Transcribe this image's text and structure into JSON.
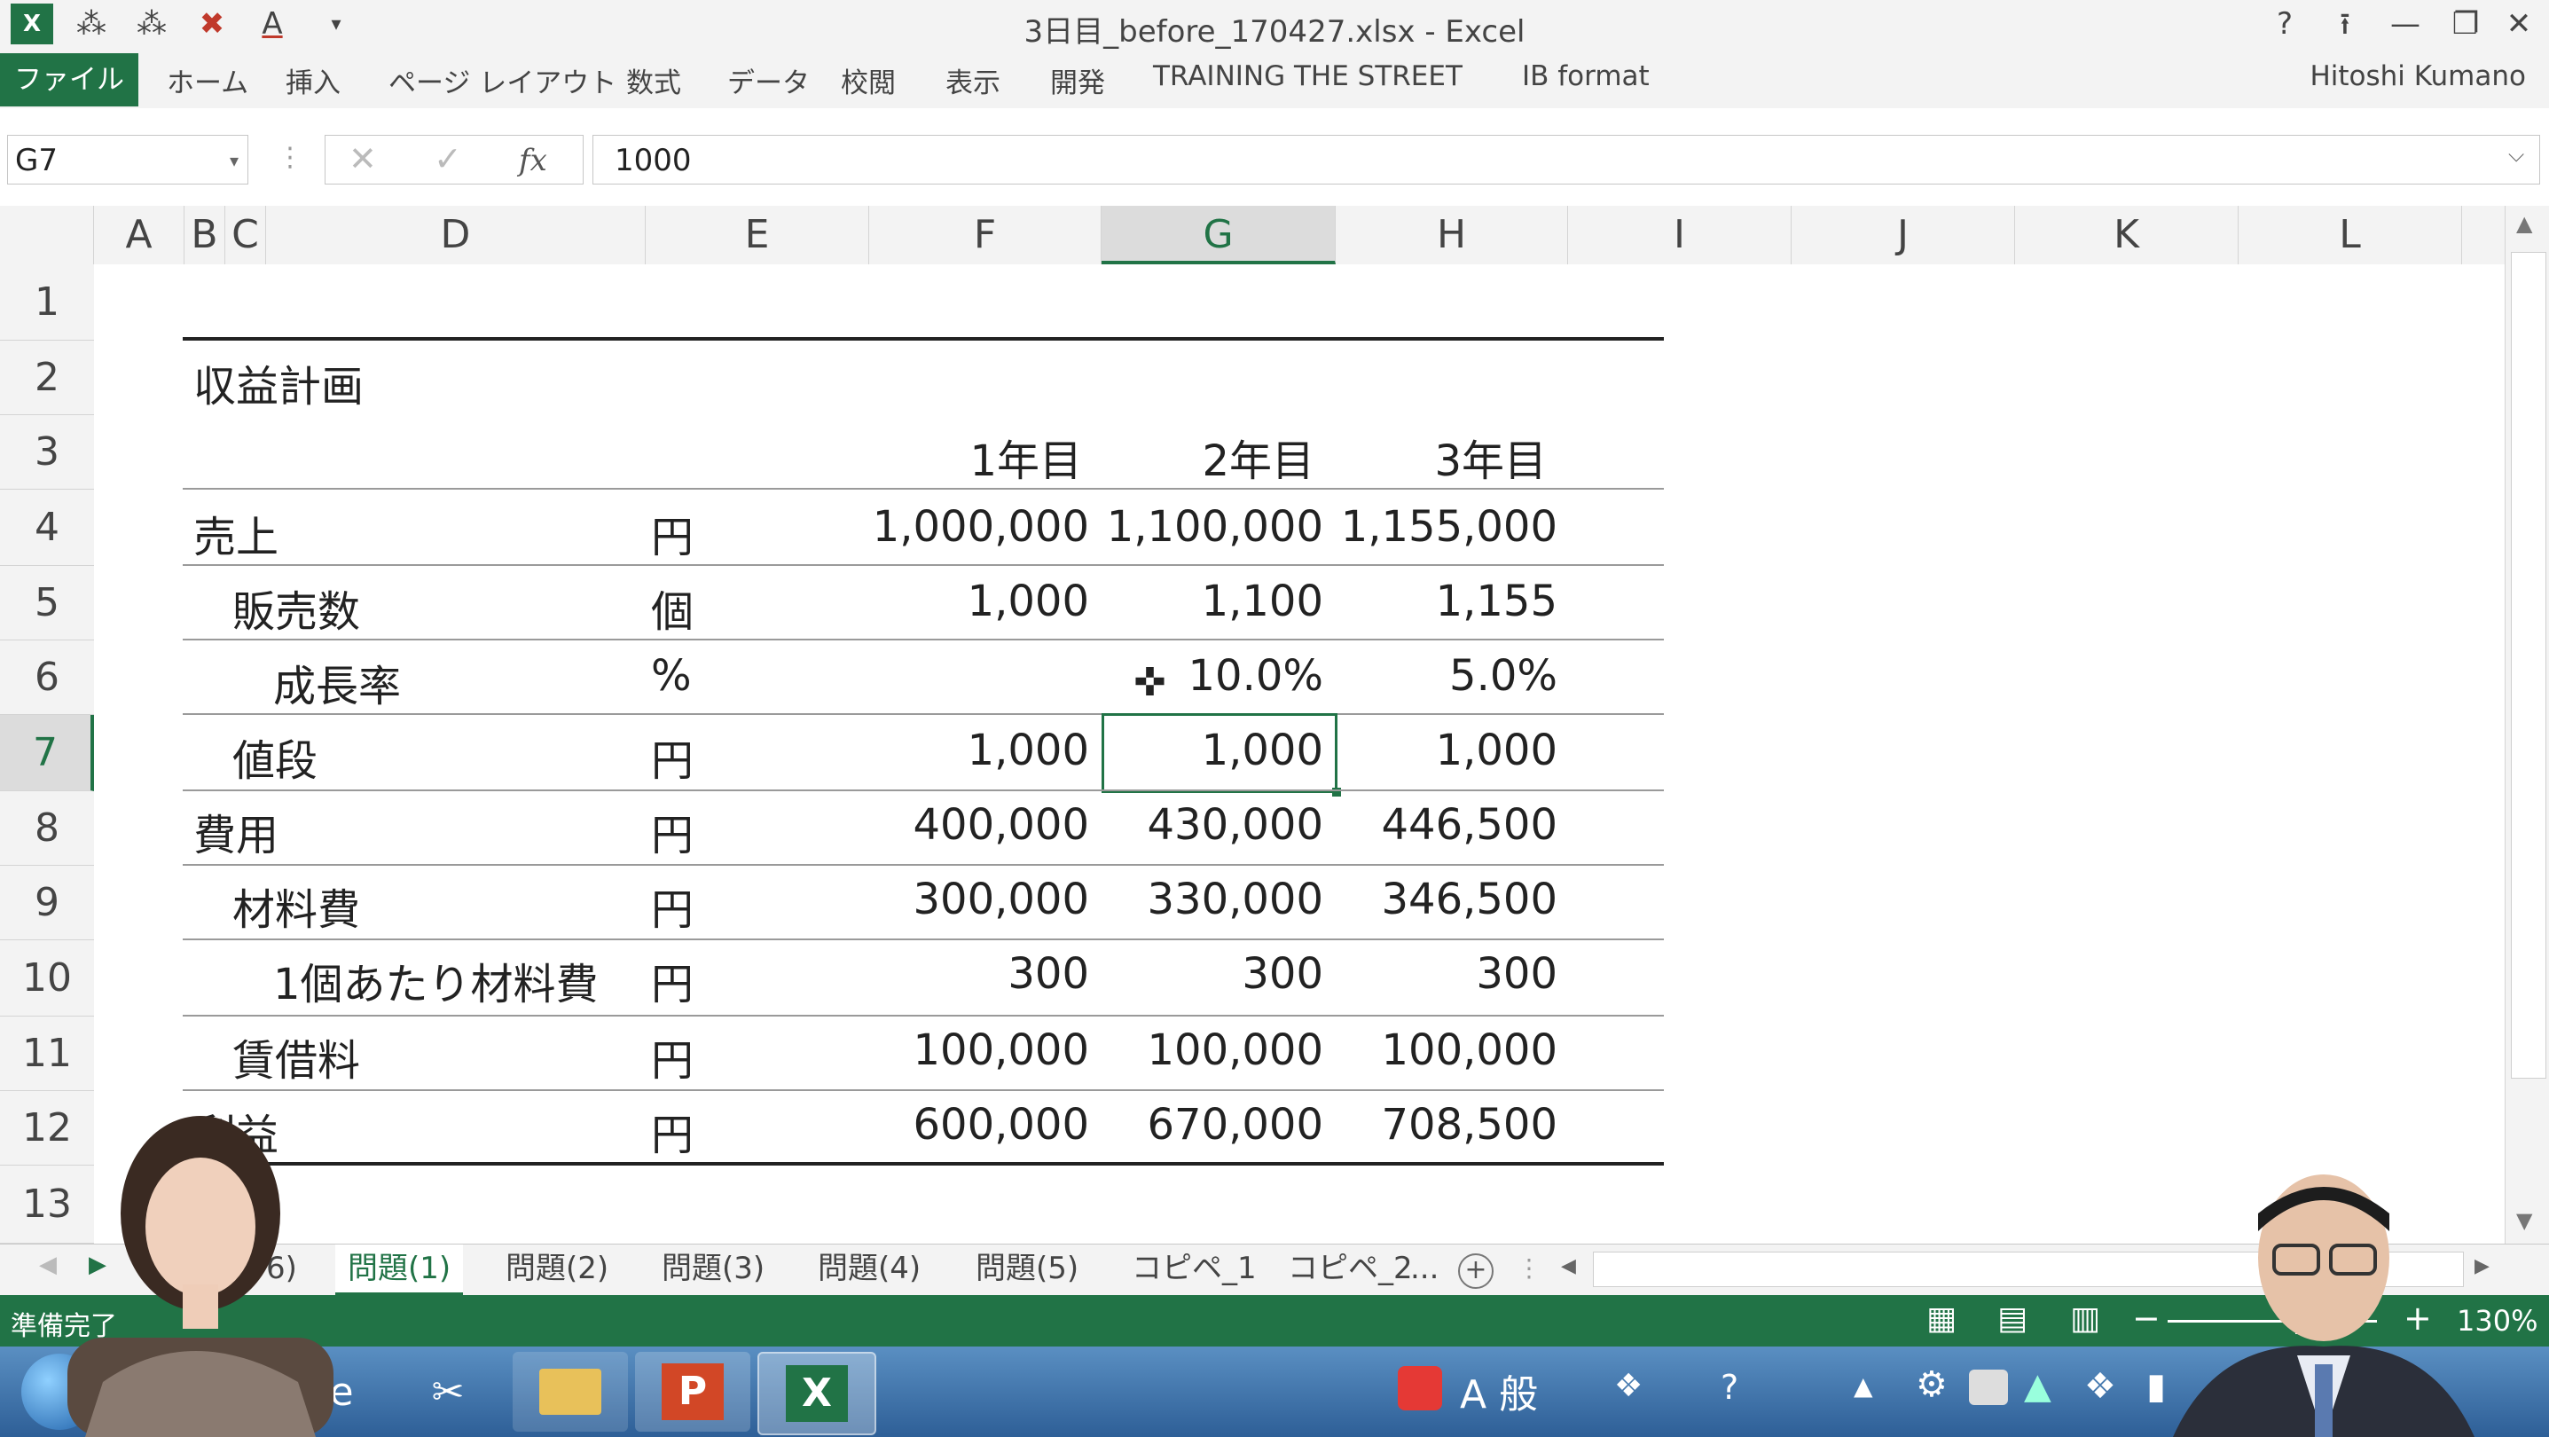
{
  "window": {
    "title": "3日目_before_170427.xlsx - Excel",
    "help_icon": "?",
    "qat_icons": [
      "excel-logo-icon",
      "smartart-icon",
      "smartart-icon",
      "clear-format-icon",
      "font-color-icon",
      "customize-icon"
    ]
  },
  "ribbon": {
    "file_tab": "ファイル",
    "tabs": [
      "ホーム",
      "挿入",
      "ページ レイアウト",
      "数式",
      "データ",
      "校閲",
      "表示",
      "開発",
      "TRAINING THE STREET",
      "IB format"
    ],
    "user": "Hitoshi Kumano"
  },
  "formula_bar": {
    "name_box": "G7",
    "fx_label": "fx",
    "formula": "1000"
  },
  "columns": [
    "A",
    "B",
    "C",
    "D",
    "E",
    "F",
    "G",
    "H",
    "I",
    "J",
    "K",
    "L"
  ],
  "selected_column": "G",
  "rows": [
    "1",
    "2",
    "3",
    "4",
    "5",
    "6",
    "7",
    "8",
    "9",
    "10",
    "11",
    "12",
    "13"
  ],
  "selected_row": "7",
  "sheet": {
    "title": "収益計画",
    "headers": [
      "1年目",
      "2年目",
      "3年目"
    ],
    "table": [
      {
        "label": "売上",
        "unit": "円",
        "values": [
          "1,000,000",
          "1,100,000",
          "1,155,000"
        ]
      },
      {
        "label": "販売数",
        "unit": "個",
        "values": [
          "1,000",
          "1,100",
          "1,155"
        ]
      },
      {
        "label": "成長率",
        "unit": "%",
        "values": [
          "",
          "10.0%",
          "5.0%"
        ]
      },
      {
        "label": "値段",
        "unit": "円",
        "values": [
          "1,000",
          "1,000",
          "1,000"
        ]
      },
      {
        "label": "費用",
        "unit": "円",
        "values": [
          "400,000",
          "430,000",
          "446,500"
        ]
      },
      {
        "label": "材料費",
        "unit": "円",
        "values": [
          "300,000",
          "330,000",
          "346,500"
        ]
      },
      {
        "label": "1個あたり材料費",
        "unit": "円",
        "values": [
          "300",
          "300",
          "300"
        ]
      },
      {
        "label": "賃借料",
        "unit": "円",
        "values": [
          "100,000",
          "100,000",
          "100,000"
        ]
      },
      {
        "label": "利益",
        "unit": "円",
        "values": [
          "600,000",
          "670,000",
          "708,500"
        ]
      }
    ]
  },
  "sheet_tabs": {
    "partial": "6)",
    "tabs": [
      "問題(1)",
      "問題(2)",
      "問題(3)",
      "問題(4)",
      "問題(5)",
      "コピペ_1",
      "コピペ_2"
    ],
    "active": "問題(1)",
    "more": "...",
    "add": "+"
  },
  "status": {
    "ready": "準備完了",
    "zoom": "130%"
  },
  "taskbar": {
    "ime_text": "A 般"
  },
  "colors": {
    "accent": "#217346",
    "ribbon_bg": "#f3f3f3"
  }
}
